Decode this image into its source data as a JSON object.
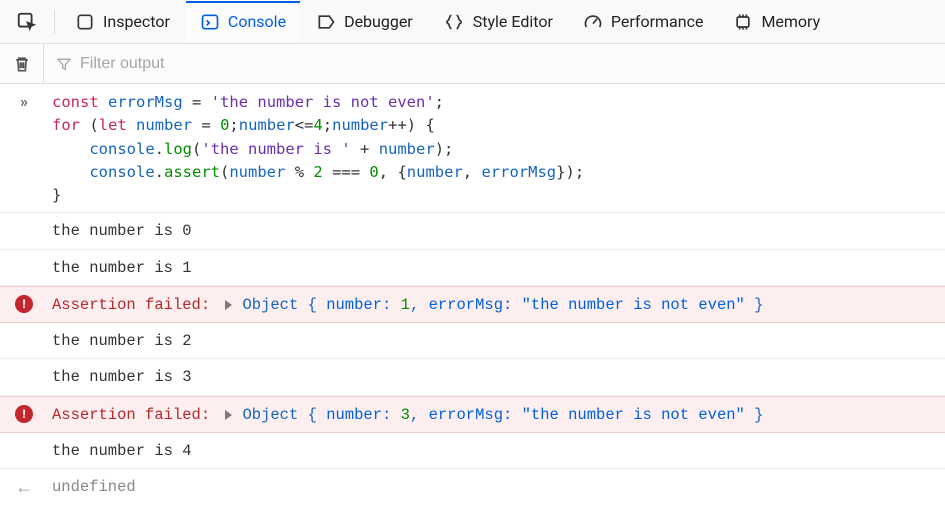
{
  "tabs": {
    "inspector": "Inspector",
    "console": "Console",
    "debugger": "Debugger",
    "style_editor": "Style Editor",
    "performance": "Performance",
    "memory": "Memory"
  },
  "active_tab": "console",
  "toolbar": {
    "filter_placeholder": "Filter output"
  },
  "code_input": {
    "line1": {
      "kw_const": "const",
      "ident": "errorMsg",
      "eq": "=",
      "str": "'the number is not even'",
      "semi": ";"
    },
    "line2": {
      "kw_for": "for",
      "lp": "(",
      "kw_let": "let",
      "ident": "number",
      "eq": "=",
      "zero": "0",
      "semi1": ";",
      "cmp_ident": "number",
      "op_le": "<=",
      "four": "4",
      "semi2": ";",
      "inc_ident": "number",
      "op_inc": "++",
      "rp": ")",
      "lbrace": "{"
    },
    "line3": {
      "obj": "console",
      "dot": ".",
      "method": "log",
      "lp": "(",
      "str": "'the number is '",
      "plus": "+",
      "ident": "number",
      "rp": ")",
      "semi": ";"
    },
    "line4": {
      "obj": "console",
      "dot": ".",
      "method": "assert",
      "lp": "(",
      "ident1": "number",
      "mod": "%",
      "two": "2",
      "eqeqeq": "===",
      "zero": "0",
      "comma": ",",
      "lbrace": "{",
      "ident2": "number",
      "comma2": ",",
      "ident3": "errorMsg",
      "rbrace": "}",
      "rp": ")",
      "semi": ";"
    },
    "line5": {
      "rbrace": "}"
    }
  },
  "logs": [
    "the number is 0",
    "the number is 1",
    "the number is 2",
    "the number is 3",
    "the number is 4"
  ],
  "assertions": [
    {
      "label": "Assertion failed:",
      "obj_word": "Object",
      "lb": "{",
      "k1": "number:",
      "v1": "1",
      "comma": ",",
      "k2": "errorMsg:",
      "v2": "\"the number is not even\"",
      "rb": "}"
    },
    {
      "label": "Assertion failed:",
      "obj_word": "Object",
      "lb": "{",
      "k1": "number:",
      "v1": "3",
      "comma": ",",
      "k2": "errorMsg:",
      "v2": "\"the number is not even\"",
      "rb": "}"
    }
  ],
  "return_value": "undefined"
}
